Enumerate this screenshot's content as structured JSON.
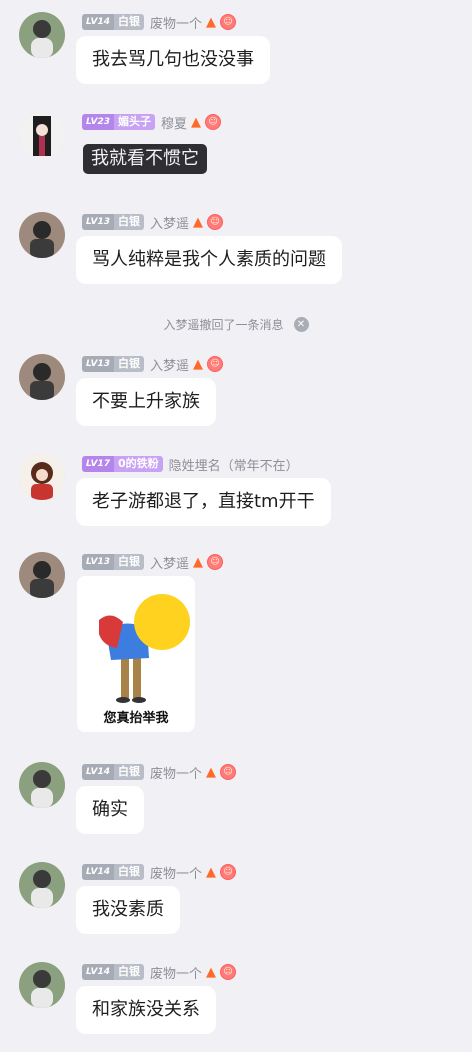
{
  "messages": [
    {
      "badge": {
        "level": "LV14",
        "title": "白银"
      },
      "name": "废物一个",
      "text": "我去骂几句也没没事"
    },
    {
      "badge": {
        "level": "LV23",
        "title": "媚头子"
      },
      "name": "穆夏",
      "text": "我就看不惯它"
    },
    {
      "badge": {
        "level": "LV13",
        "title": "白银"
      },
      "name": "入梦遥",
      "text": "骂人纯粹是我个人素质的问题"
    },
    {
      "badge": {
        "level": "LV13",
        "title": "白银"
      },
      "name": "入梦遥",
      "text": "不要上升家族"
    },
    {
      "badge": {
        "level": "LV17",
        "title": "0的铁粉"
      },
      "name": "隐姓埋名（常年不在）",
      "text": "老子游都退了，直接tm开干"
    },
    {
      "badge": {
        "level": "LV13",
        "title": "白银"
      },
      "name": "入梦遥",
      "sticker_caption": "您真抬举我"
    },
    {
      "badge": {
        "level": "LV14",
        "title": "白银"
      },
      "name": "废物一个",
      "text": "确实"
    },
    {
      "badge": {
        "level": "LV14",
        "title": "白银"
      },
      "name": "废物一个",
      "text": "我没素质"
    },
    {
      "badge": {
        "level": "LV14",
        "title": "白银"
      },
      "name": "废物一个",
      "text": "和家族没关系"
    }
  ],
  "system_notice": "入梦遥撤回了一条消息",
  "icons": {
    "fire": "fire-icon",
    "face": "smile-face-icon",
    "close": "close-icon"
  },
  "colors": {
    "background": "#f1f1f5",
    "bubble": "#ffffff",
    "badge_gray": "#b9bdc7",
    "badge_purple": "#c8a2f3"
  }
}
